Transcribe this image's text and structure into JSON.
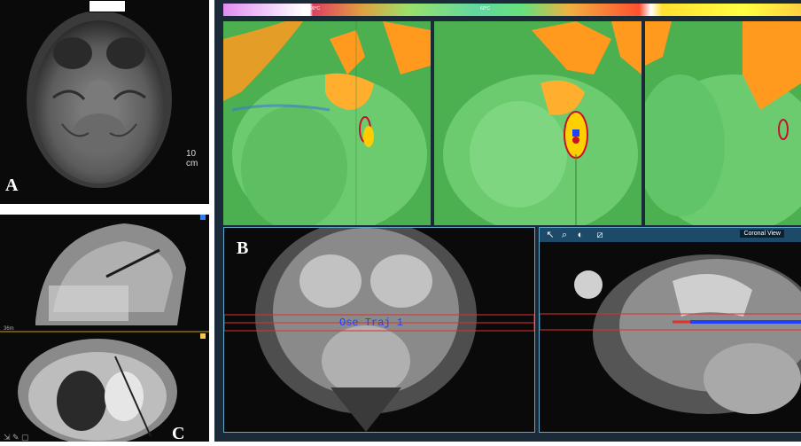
{
  "panels": {
    "a": {
      "letter": "A",
      "scale_label": "10 cm"
    },
    "b": {
      "letter": "B",
      "colorbar": {
        "labels": [
          "90°C",
          "60°C"
        ]
      },
      "trajectory_label": "Ose Traj 1",
      "coronal_toolbar": {
        "tools": [
          {
            "name": "pointer-icon",
            "glyph": "↖"
          },
          {
            "name": "zoom-icon",
            "glyph": "⌕"
          },
          {
            "name": "contrast-icon",
            "glyph": "◐"
          },
          {
            "name": "ruler-icon",
            "glyph": "⧄"
          }
        ],
        "view_label": "Coronal View"
      }
    },
    "c": {
      "letter": "C",
      "side_label": "36m"
    }
  },
  "colors": {
    "thermal_green": "#4caf50",
    "heat_orange": "#ff9a1f",
    "ablation_outline": "#c8102e",
    "trajectory_line": "#e03030",
    "trajectory_tool": "#2040ff",
    "ui_frame": "#5fa8c8",
    "background_dark": "#1a2a38"
  }
}
